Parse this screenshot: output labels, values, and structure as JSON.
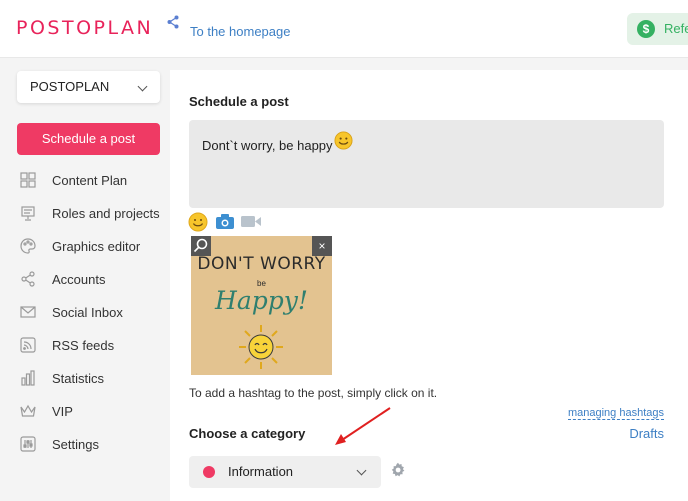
{
  "header": {
    "logo": "POSTOPLAN",
    "home_link": "To the homepage",
    "refer_label": "Refe",
    "refer_icon": "$"
  },
  "sidebar": {
    "project": "POSTOPLAN",
    "schedule_button": "Schedule a post",
    "items": [
      {
        "label": "Content Plan",
        "icon": "grid-icon"
      },
      {
        "label": "Roles and projects",
        "icon": "presentation-icon"
      },
      {
        "label": "Graphics editor",
        "icon": "palette-icon"
      },
      {
        "label": "Accounts",
        "icon": "share-icon"
      },
      {
        "label": "Social Inbox",
        "icon": "envelope-icon"
      },
      {
        "label": "RSS feeds",
        "icon": "rss-icon"
      },
      {
        "label": "Statistics",
        "icon": "bar-chart-icon"
      },
      {
        "label": "VIP",
        "icon": "crown-icon"
      },
      {
        "label": "Settings",
        "icon": "sliders-icon"
      }
    ]
  },
  "main": {
    "title": "Schedule a post",
    "post_text": "Dont`t worry, be happy",
    "image_text": {
      "line1": "DON'T WORRY",
      "line2": "be",
      "line3": "Happy!"
    },
    "close_label": "×",
    "hashtag_hint": "To add a hashtag to the post, simply click on it.",
    "managing_hashtags": "managing hashtags",
    "drafts": "Drafts",
    "category_title": "Choose a category",
    "category_value": "Information"
  },
  "colors": {
    "brand": "#e8235a",
    "primary_button": "#ef3a64",
    "link": "#3d7fc4",
    "refer_green": "#35b162",
    "category_dot": "#ef3a64"
  }
}
